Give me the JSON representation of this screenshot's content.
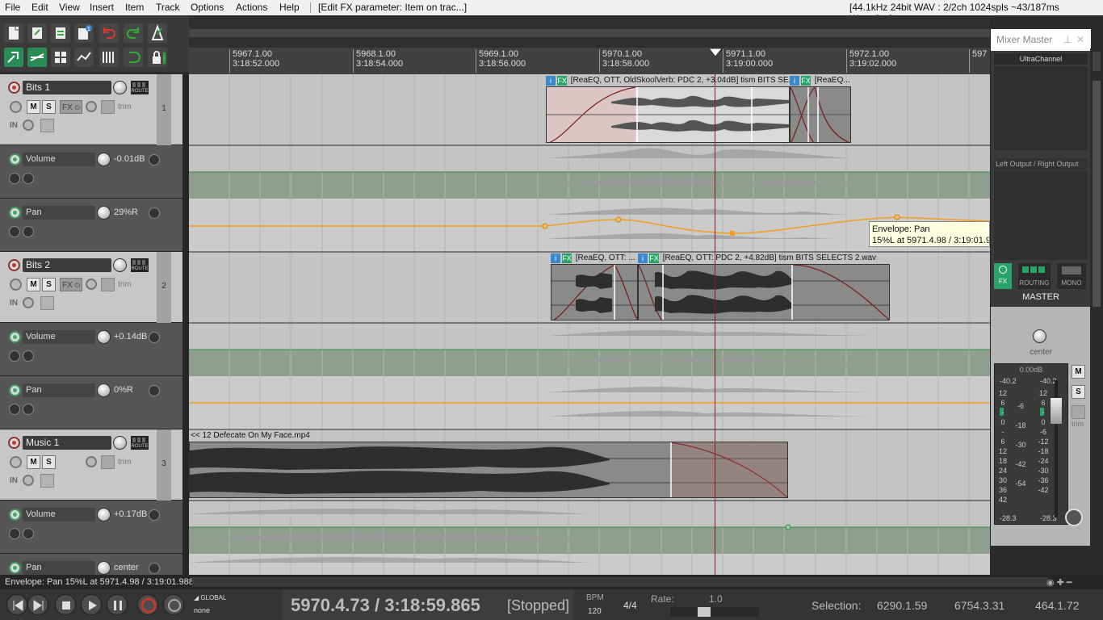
{
  "menubar": {
    "items": [
      "File",
      "Edit",
      "View",
      "Insert",
      "Item",
      "Track",
      "Options",
      "Actions",
      "Help"
    ],
    "context": "[Edit FX parameter: Item on trac...]",
    "audio_status": "[44.1kHz 24bit WAV : 2/2ch 1024spls ~43/187ms WaveOut]"
  },
  "ruler": {
    "marks": [
      {
        "beat": "5967.1.00",
        "time": "3:18:52.000"
      },
      {
        "beat": "5968.1.00",
        "time": "3:18:54.000"
      },
      {
        "beat": "5969.1.00",
        "time": "3:18:56.000"
      },
      {
        "beat": "5970.1.00",
        "time": "3:18:58.000"
      },
      {
        "beat": "5971.1.00",
        "time": "3:19:00.000"
      },
      {
        "beat": "5972.1.00",
        "time": "3:19:02.000"
      },
      {
        "beat": "597",
        "time": ""
      }
    ]
  },
  "tracks": [
    {
      "name": "Bits 1",
      "number": "1",
      "route_label": "ROUTE",
      "m_label": "M",
      "s_label": "S",
      "fx_label": "FX",
      "trim_label": "trim",
      "in_label": "IN",
      "volume": {
        "label": "Volume",
        "value": "-0.01dB"
      },
      "pan": {
        "label": "Pan",
        "value": "29%R"
      }
    },
    {
      "name": "Bits 2",
      "number": "2",
      "route_label": "ROUTE",
      "m_label": "M",
      "s_label": "S",
      "fx_label": "FX",
      "trim_label": "trim",
      "in_label": "IN",
      "volume": {
        "label": "Volume",
        "value": "+0.14dB"
      },
      "pan": {
        "label": "Pan",
        "value": "0%R"
      }
    },
    {
      "name": "Music 1",
      "number": "3",
      "route_label": "ROUTE",
      "m_label": "M",
      "s_label": "S",
      "fx_label": "",
      "trim_label": "trim",
      "in_label": "IN",
      "volume": {
        "label": "Volume",
        "value": "+0.17dB"
      },
      "pan": {
        "label": "Pan",
        "value": "center"
      }
    }
  ],
  "items": {
    "bits1_a": {
      "i": "i",
      "fx": "FX",
      "title": "[ReaEQ, OTT, OldSkoolVerb: PDC 2,  +3.04dB] tism BITS SE..."
    },
    "bits1_b": {
      "i": "i",
      "fx": "FX",
      "title": "[ReaEQ..."
    },
    "bits2_a": {
      "i": "i",
      "fx": "FX",
      "title": "[ReaEQ, OTT: ..."
    },
    "bits2_b": {
      "i": "i",
      "fx": "FX",
      "title": "[ReaEQ, OTT: PDC 2,  +4.82dB] tism BITS SELECTS 2.wav"
    },
    "music1": {
      "title": "<< 12 Defecate On My Face.mp4"
    }
  },
  "tooltip": {
    "line1": "Envelope: Pan",
    "line2": "15%L at 5971.4.98 / 3:19:01.988"
  },
  "mixer": {
    "title": "Mixer Master",
    "fx_slot": "UltraChannel",
    "output": "Left Output / Right Output",
    "fx_label": "FX",
    "routing_label": "ROUTING",
    "mono_label": "MONO",
    "master_label": "MASTER",
    "pan_label": "center",
    "db_readout": "0.00dB",
    "peak_left": "-40.2",
    "peak_right": "-40.2",
    "scale_left": [
      "12",
      "6",
      "-",
      "0",
      "-",
      "6",
      "12",
      "18",
      "24",
      "30",
      "36",
      "42"
    ],
    "scale_mid": [
      "-6",
      "-18",
      "-30",
      "-42",
      "-54"
    ],
    "scale_right": [
      "12",
      "6",
      "-",
      "0",
      "-6",
      "-12",
      "-18",
      "-24",
      "-30",
      "-36",
      "-42"
    ],
    "rms_left": "-28.3",
    "rms_right": "-28.3",
    "m_label": "M",
    "s_label": "S",
    "trim_label": "trim",
    "fader_level": 0.86
  },
  "status": {
    "text": "Envelope: Pan 15%L at 5971.4.98 / 3:19:01.988"
  },
  "transport": {
    "global_label": "GLOBAL",
    "none_label": "none",
    "position": "5970.4.73 / 3:18:59.865",
    "state": "[Stopped]",
    "bpm_label": "BPM",
    "bpm_value": "120",
    "time_sig": "4/4",
    "rate_label": "Rate:",
    "rate_value": "1.0",
    "selection_label": "Selection:",
    "sel_start": "6290.1.59",
    "sel_end": "6754.3.31",
    "sel_len": "464.1.72"
  },
  "colors": {
    "envelope_pan": "#f0a020",
    "envelope_volume": "#3c8a4a",
    "fade_curve": "#7a1a1a",
    "record_arm": "#c0392b",
    "accent_green": "#2aa36a"
  }
}
